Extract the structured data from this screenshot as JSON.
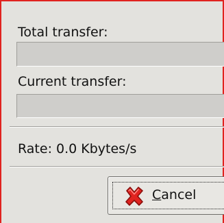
{
  "dialog": {
    "total_transfer_label": "Total transfer:",
    "total_transfer_progress": 0,
    "current_transfer_label": "Current transfer:",
    "current_transfer_progress": 0,
    "rate_text": "Rate: 0.0 Kbytes/s",
    "cancel_mnemonic": "C",
    "cancel_rest": "ancel",
    "cancel_icon": "red-x-cancel-icon"
  },
  "colors": {
    "window_border": "#e0231f",
    "background": "#e3e2de",
    "trough": "#cfcecb",
    "cancel_icon_red": "#e0231f"
  }
}
